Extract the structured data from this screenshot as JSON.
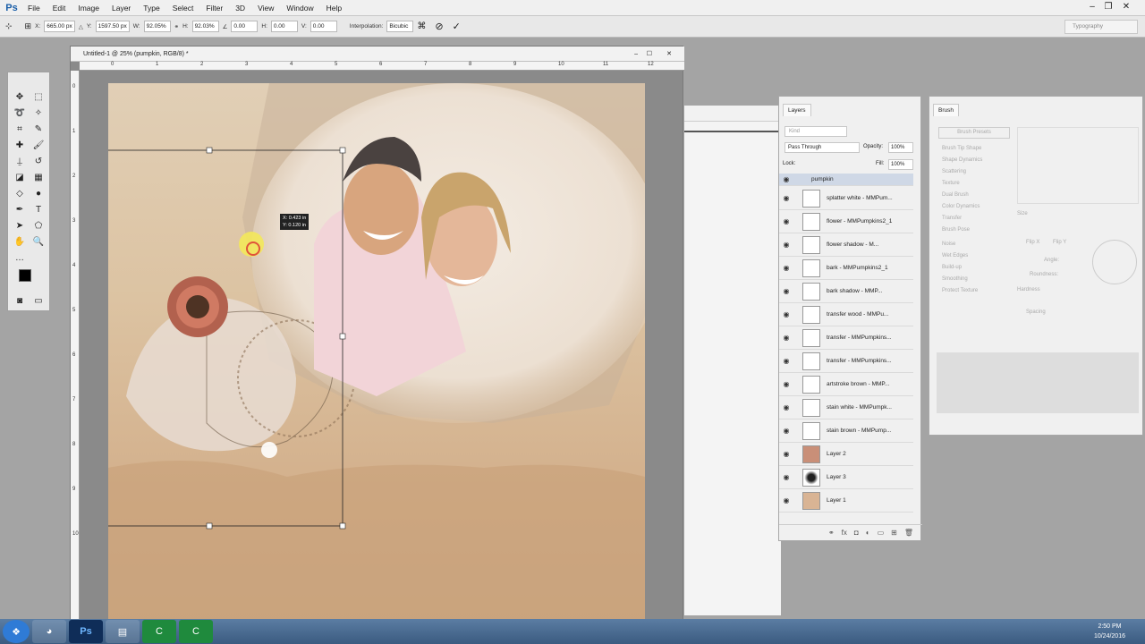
{
  "app": {
    "logo": "Ps"
  },
  "menu": [
    "File",
    "Edit",
    "Image",
    "Layer",
    "Type",
    "Select",
    "Filter",
    "3D",
    "View",
    "Window",
    "Help"
  ],
  "options": {
    "x_label": "X:",
    "x_value": "665.00 px",
    "y_label": "Y:",
    "y_value": "1597.50 px",
    "w_label": "W:",
    "w_value": "92.05%",
    "h_label": "H:",
    "h_value": "92.03%",
    "angle_value": "0.00",
    "hskew_label": "H:",
    "hskew_value": "0.00",
    "vskew_label": "V:",
    "vskew_value": "0.00",
    "interp_label": "Interpolation:",
    "interp_value": "Bicubic"
  },
  "workspace": "Typography",
  "document": {
    "title": "Untitled-1 @ 25% (pumpkin, RGB/8) *",
    "ruler_top": [
      "0",
      "1",
      "2",
      "3",
      "4",
      "5",
      "6",
      "7",
      "8",
      "9",
      "10",
      "11",
      "12"
    ],
    "ruler_left": [
      "0",
      "1",
      "2",
      "3",
      "4",
      "5",
      "6",
      "7",
      "8",
      "9",
      "10"
    ],
    "tooltip": [
      "X: 0.423 in",
      "Y: 0.120 in"
    ]
  },
  "layers_panel": {
    "tab": "Layers",
    "kind_placeholder": "Kind",
    "blend_mode": "Pass Through",
    "opacity_label": "Opacity:",
    "opacity_value": "100%",
    "lock_label": "Lock:",
    "fill_label": "Fill:",
    "fill_value": "100%",
    "group": "pumpkin",
    "layers": [
      "splatter white - MMPum...",
      "flower - MMPumpkins2_1",
      "flower shadow - M...",
      "bark - MMPumpkins2_1",
      "bark shadow - MMP...",
      "transfer wood - MMPu...",
      "transfer - MMPumpkins...",
      "transfer - MMPumpkins...",
      "artstroke brown - MMP...",
      "stain white - MMPumpk...",
      "stain brown - MMPump...",
      "Layer 2",
      "Layer 3",
      "Layer 1"
    ]
  },
  "brush_panel": {
    "tab": "Brush",
    "presets_button": "Brush Presets",
    "options": [
      "Brush Tip Shape",
      "Shape Dynamics",
      "Scattering",
      "Texture",
      "Dual Brush",
      "Color Dynamics",
      "Transfer",
      "Brush Pose",
      "Noise",
      "Wet Edges",
      "Build-up",
      "Smoothing",
      "Protect Texture"
    ],
    "size_label": "Size",
    "flip_x": "Flip X",
    "flip_y": "Flip Y",
    "angle_label": "Angle:",
    "roundness_label": "Roundness:",
    "hardness_label": "Hardness",
    "spacing_label": "Spacing"
  },
  "taskbar": {
    "time": "2:50 PM",
    "date": "10/24/2016"
  },
  "colors": {
    "accent": "#1a5ea8",
    "canvas_bg": "#dcc3a2",
    "selected_row": "#cfd8e6"
  }
}
